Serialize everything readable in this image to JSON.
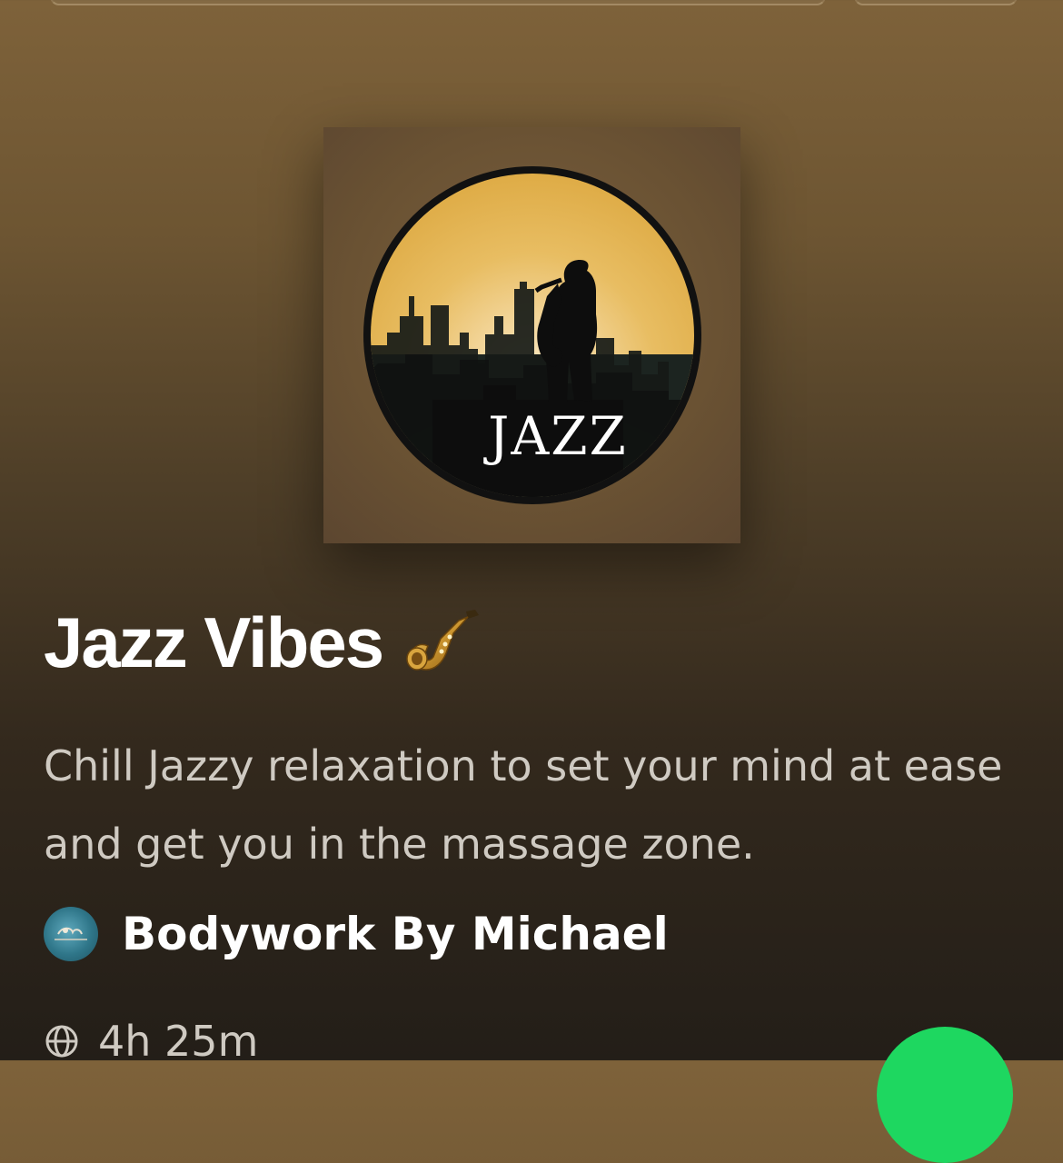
{
  "header": {
    "search_field": "",
    "sort_field": ""
  },
  "cover": {
    "art_text": "JAZZ",
    "accent_color": "#e9b94f"
  },
  "playlist": {
    "title": "Jazz Vibes",
    "title_emoji_icon": "saxophone-icon",
    "description": "Chill Jazzy relaxation to set your mind at ease and get you in the massage zone.",
    "owner": {
      "name": "Bodywork By Michael",
      "avatar_icon": "avatar"
    },
    "visibility_icon": "globe-icon",
    "duration": "4h 25m"
  },
  "controls": {
    "play_button_color": "#1ed760"
  }
}
